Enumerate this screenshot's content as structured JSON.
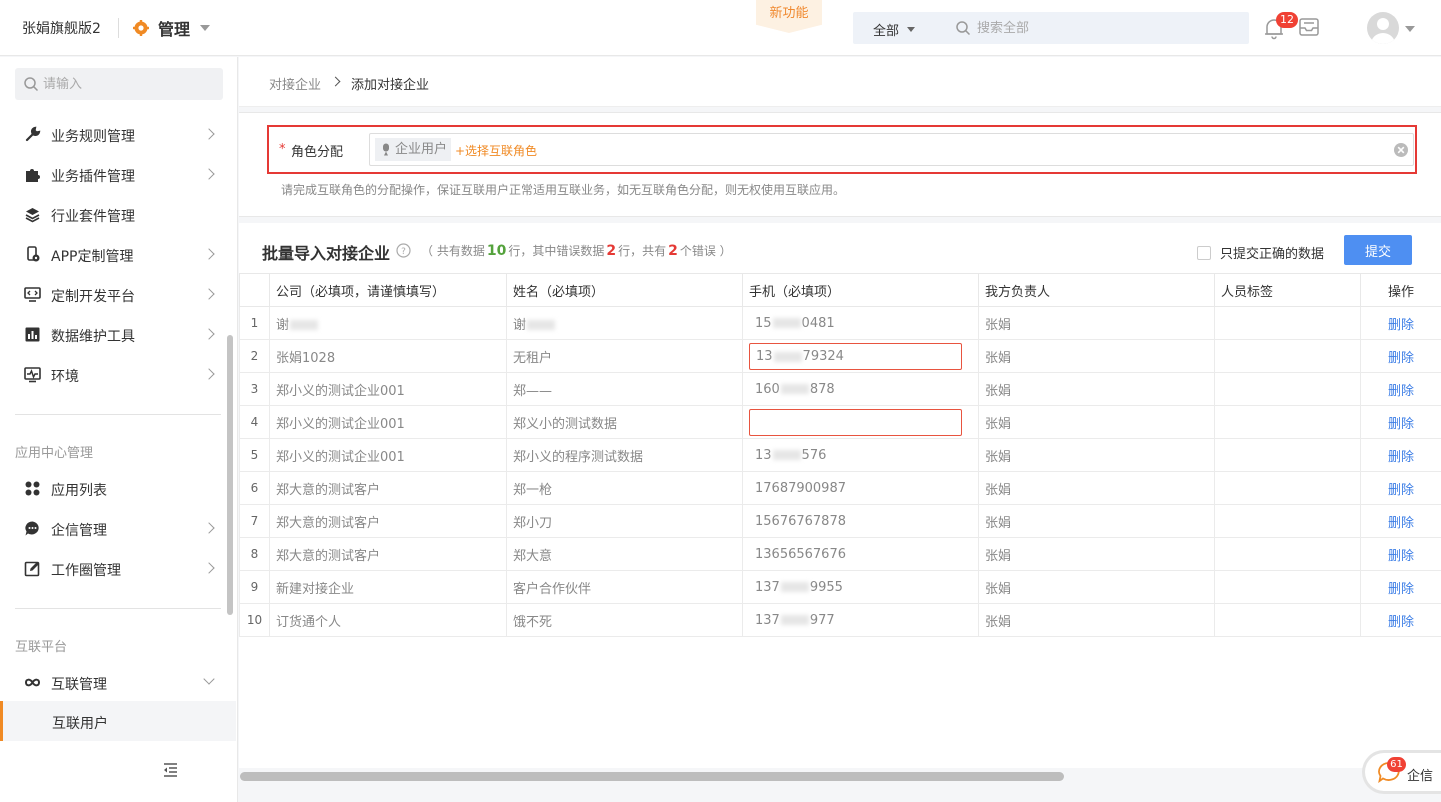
{
  "header": {
    "org_name": "张娟旗舰版2",
    "module": "管理",
    "new_feature": "新功能",
    "search_scope": "全部",
    "search_placeholder": "搜索全部",
    "notification_count": "12"
  },
  "sidebar": {
    "search_placeholder": "请输入",
    "items": [
      {
        "label": "业务规则管理",
        "icon": "wrench-icon"
      },
      {
        "label": "业务插件管理",
        "icon": "puzzle-icon"
      },
      {
        "label": "行业套件管理",
        "icon": "layers-icon"
      },
      {
        "label": "APP定制管理",
        "icon": "app-gear-icon"
      },
      {
        "label": "定制开发平台",
        "icon": "code-monitor-icon"
      },
      {
        "label": "数据维护工具",
        "icon": "bar-chart-icon"
      },
      {
        "label": "环境",
        "icon": "pulse-monitor-icon"
      }
    ],
    "group_app_center": "应用中心管理",
    "app_items": [
      {
        "label": "应用列表",
        "icon": "grid-icon"
      },
      {
        "label": "企信管理",
        "icon": "chat-icon"
      },
      {
        "label": "工作圈管理",
        "icon": "edit-icon"
      }
    ],
    "group_interconnect": "互联平台",
    "interconnect_item": {
      "label": "互联管理",
      "icon": "link-icon"
    },
    "sub_item": "互联用户"
  },
  "breadcrumb": {
    "parent": "对接企业",
    "current": "添加对接企业"
  },
  "role": {
    "required_mark": "*",
    "label": "角色分配",
    "tag": "企业用户",
    "add_label": "+选择互联角色",
    "hint": "请完成互联角色的分配操作，保证互联用户正常适用互联业务，如无互联角色分配，则无权使用互联应用。"
  },
  "import": {
    "title": "批量导入对接企业",
    "stats_prefix": "（ 共有数据 ",
    "total_rows": "10",
    "stats_mid1": " 行，其中错误数据 ",
    "error_rows": "2",
    "stats_mid2": " 行，共有 ",
    "error_count": "2",
    "stats_suffix": " 个错误 ）",
    "only_correct_label": "只提交正确的数据",
    "submit_label": "提交",
    "columns": [
      "公司（必填项，请谨慎填写）",
      "姓名（必填项）",
      "手机（必填项）",
      "我方负责人",
      "人员标签",
      "操作"
    ],
    "delete_label": "删除",
    "rows": [
      {
        "idx": "1",
        "company": "谢",
        "name": "谢",
        "phone": "15",
        "phone_tail": "0481",
        "owner": "张娟",
        "error": false
      },
      {
        "idx": "2",
        "company": "张娟1028",
        "name": "无租户",
        "phone": "13",
        "phone_tail": "79324",
        "owner": "张娟",
        "error": true
      },
      {
        "idx": "3",
        "company": "郑小义的测试企业001",
        "name": "郑——",
        "phone": "160",
        "phone_tail": "878",
        "owner": "张娟",
        "error": false
      },
      {
        "idx": "4",
        "company": "郑小义的测试企业001",
        "name": "郑义小的测试数据",
        "phone": "",
        "phone_tail": "",
        "owner": "张娟",
        "error": true
      },
      {
        "idx": "5",
        "company": "郑小义的测试企业001",
        "name": "郑小义的程序测试数据",
        "phone": "13",
        "phone_tail": "576",
        "owner": "张娟",
        "error": false
      },
      {
        "idx": "6",
        "company": "郑大意的测试客户",
        "name": "郑一枪",
        "phone": "17687900987",
        "phone_tail": "",
        "owner": "张娟",
        "error": false
      },
      {
        "idx": "7",
        "company": "郑大意的测试客户",
        "name": "郑小刀",
        "phone": "15676767878",
        "phone_tail": "",
        "owner": "张娟",
        "error": false
      },
      {
        "idx": "8",
        "company": "郑大意的测试客户",
        "name": "郑大意",
        "phone": "13656567676",
        "phone_tail": "",
        "owner": "张娟",
        "error": false
      },
      {
        "idx": "9",
        "company": "新建对接企业",
        "name": "客户合作伙伴",
        "phone": "137",
        "phone_tail": "9955",
        "owner": "张娟",
        "error": false
      },
      {
        "idx": "10",
        "company": "订货通个人",
        "name": "饿不死",
        "phone": "137",
        "phone_tail": "977",
        "owner": "张娟",
        "error": false
      }
    ]
  },
  "chat": {
    "label": "企信",
    "badge": "61"
  },
  "colors": {
    "accent": "#f08a24",
    "primary": "#4e8ff2",
    "error": "#e53935",
    "success": "#54a23c"
  }
}
